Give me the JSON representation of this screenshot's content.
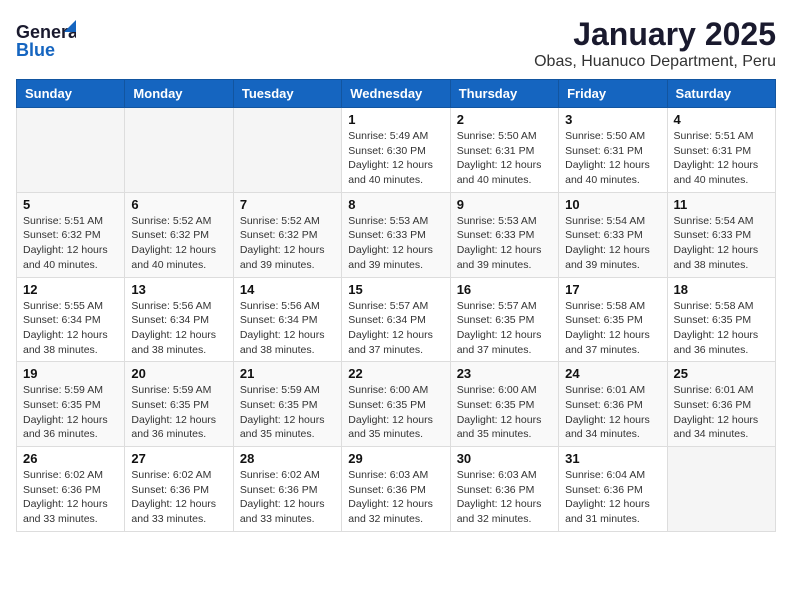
{
  "header": {
    "logo_line1": "General",
    "logo_line2": "Blue",
    "title": "January 2025",
    "subtitle": "Obas, Huanuco Department, Peru"
  },
  "days_of_week": [
    "Sunday",
    "Monday",
    "Tuesday",
    "Wednesday",
    "Thursday",
    "Friday",
    "Saturday"
  ],
  "weeks": [
    [
      {
        "day": "",
        "info": ""
      },
      {
        "day": "",
        "info": ""
      },
      {
        "day": "",
        "info": ""
      },
      {
        "day": "1",
        "info": "Sunrise: 5:49 AM\nSunset: 6:30 PM\nDaylight: 12 hours\nand 40 minutes."
      },
      {
        "day": "2",
        "info": "Sunrise: 5:50 AM\nSunset: 6:31 PM\nDaylight: 12 hours\nand 40 minutes."
      },
      {
        "day": "3",
        "info": "Sunrise: 5:50 AM\nSunset: 6:31 PM\nDaylight: 12 hours\nand 40 minutes."
      },
      {
        "day": "4",
        "info": "Sunrise: 5:51 AM\nSunset: 6:31 PM\nDaylight: 12 hours\nand 40 minutes."
      }
    ],
    [
      {
        "day": "5",
        "info": "Sunrise: 5:51 AM\nSunset: 6:32 PM\nDaylight: 12 hours\nand 40 minutes."
      },
      {
        "day": "6",
        "info": "Sunrise: 5:52 AM\nSunset: 6:32 PM\nDaylight: 12 hours\nand 40 minutes."
      },
      {
        "day": "7",
        "info": "Sunrise: 5:52 AM\nSunset: 6:32 PM\nDaylight: 12 hours\nand 39 minutes."
      },
      {
        "day": "8",
        "info": "Sunrise: 5:53 AM\nSunset: 6:33 PM\nDaylight: 12 hours\nand 39 minutes."
      },
      {
        "day": "9",
        "info": "Sunrise: 5:53 AM\nSunset: 6:33 PM\nDaylight: 12 hours\nand 39 minutes."
      },
      {
        "day": "10",
        "info": "Sunrise: 5:54 AM\nSunset: 6:33 PM\nDaylight: 12 hours\nand 39 minutes."
      },
      {
        "day": "11",
        "info": "Sunrise: 5:54 AM\nSunset: 6:33 PM\nDaylight: 12 hours\nand 38 minutes."
      }
    ],
    [
      {
        "day": "12",
        "info": "Sunrise: 5:55 AM\nSunset: 6:34 PM\nDaylight: 12 hours\nand 38 minutes."
      },
      {
        "day": "13",
        "info": "Sunrise: 5:56 AM\nSunset: 6:34 PM\nDaylight: 12 hours\nand 38 minutes."
      },
      {
        "day": "14",
        "info": "Sunrise: 5:56 AM\nSunset: 6:34 PM\nDaylight: 12 hours\nand 38 minutes."
      },
      {
        "day": "15",
        "info": "Sunrise: 5:57 AM\nSunset: 6:34 PM\nDaylight: 12 hours\nand 37 minutes."
      },
      {
        "day": "16",
        "info": "Sunrise: 5:57 AM\nSunset: 6:35 PM\nDaylight: 12 hours\nand 37 minutes."
      },
      {
        "day": "17",
        "info": "Sunrise: 5:58 AM\nSunset: 6:35 PM\nDaylight: 12 hours\nand 37 minutes."
      },
      {
        "day": "18",
        "info": "Sunrise: 5:58 AM\nSunset: 6:35 PM\nDaylight: 12 hours\nand 36 minutes."
      }
    ],
    [
      {
        "day": "19",
        "info": "Sunrise: 5:59 AM\nSunset: 6:35 PM\nDaylight: 12 hours\nand 36 minutes."
      },
      {
        "day": "20",
        "info": "Sunrise: 5:59 AM\nSunset: 6:35 PM\nDaylight: 12 hours\nand 36 minutes."
      },
      {
        "day": "21",
        "info": "Sunrise: 5:59 AM\nSunset: 6:35 PM\nDaylight: 12 hours\nand 35 minutes."
      },
      {
        "day": "22",
        "info": "Sunrise: 6:00 AM\nSunset: 6:35 PM\nDaylight: 12 hours\nand 35 minutes."
      },
      {
        "day": "23",
        "info": "Sunrise: 6:00 AM\nSunset: 6:35 PM\nDaylight: 12 hours\nand 35 minutes."
      },
      {
        "day": "24",
        "info": "Sunrise: 6:01 AM\nSunset: 6:36 PM\nDaylight: 12 hours\nand 34 minutes."
      },
      {
        "day": "25",
        "info": "Sunrise: 6:01 AM\nSunset: 6:36 PM\nDaylight: 12 hours\nand 34 minutes."
      }
    ],
    [
      {
        "day": "26",
        "info": "Sunrise: 6:02 AM\nSunset: 6:36 PM\nDaylight: 12 hours\nand 33 minutes."
      },
      {
        "day": "27",
        "info": "Sunrise: 6:02 AM\nSunset: 6:36 PM\nDaylight: 12 hours\nand 33 minutes."
      },
      {
        "day": "28",
        "info": "Sunrise: 6:02 AM\nSunset: 6:36 PM\nDaylight: 12 hours\nand 33 minutes."
      },
      {
        "day": "29",
        "info": "Sunrise: 6:03 AM\nSunset: 6:36 PM\nDaylight: 12 hours\nand 32 minutes."
      },
      {
        "day": "30",
        "info": "Sunrise: 6:03 AM\nSunset: 6:36 PM\nDaylight: 12 hours\nand 32 minutes."
      },
      {
        "day": "31",
        "info": "Sunrise: 6:04 AM\nSunset: 6:36 PM\nDaylight: 12 hours\nand 31 minutes."
      },
      {
        "day": "",
        "info": ""
      }
    ]
  ]
}
